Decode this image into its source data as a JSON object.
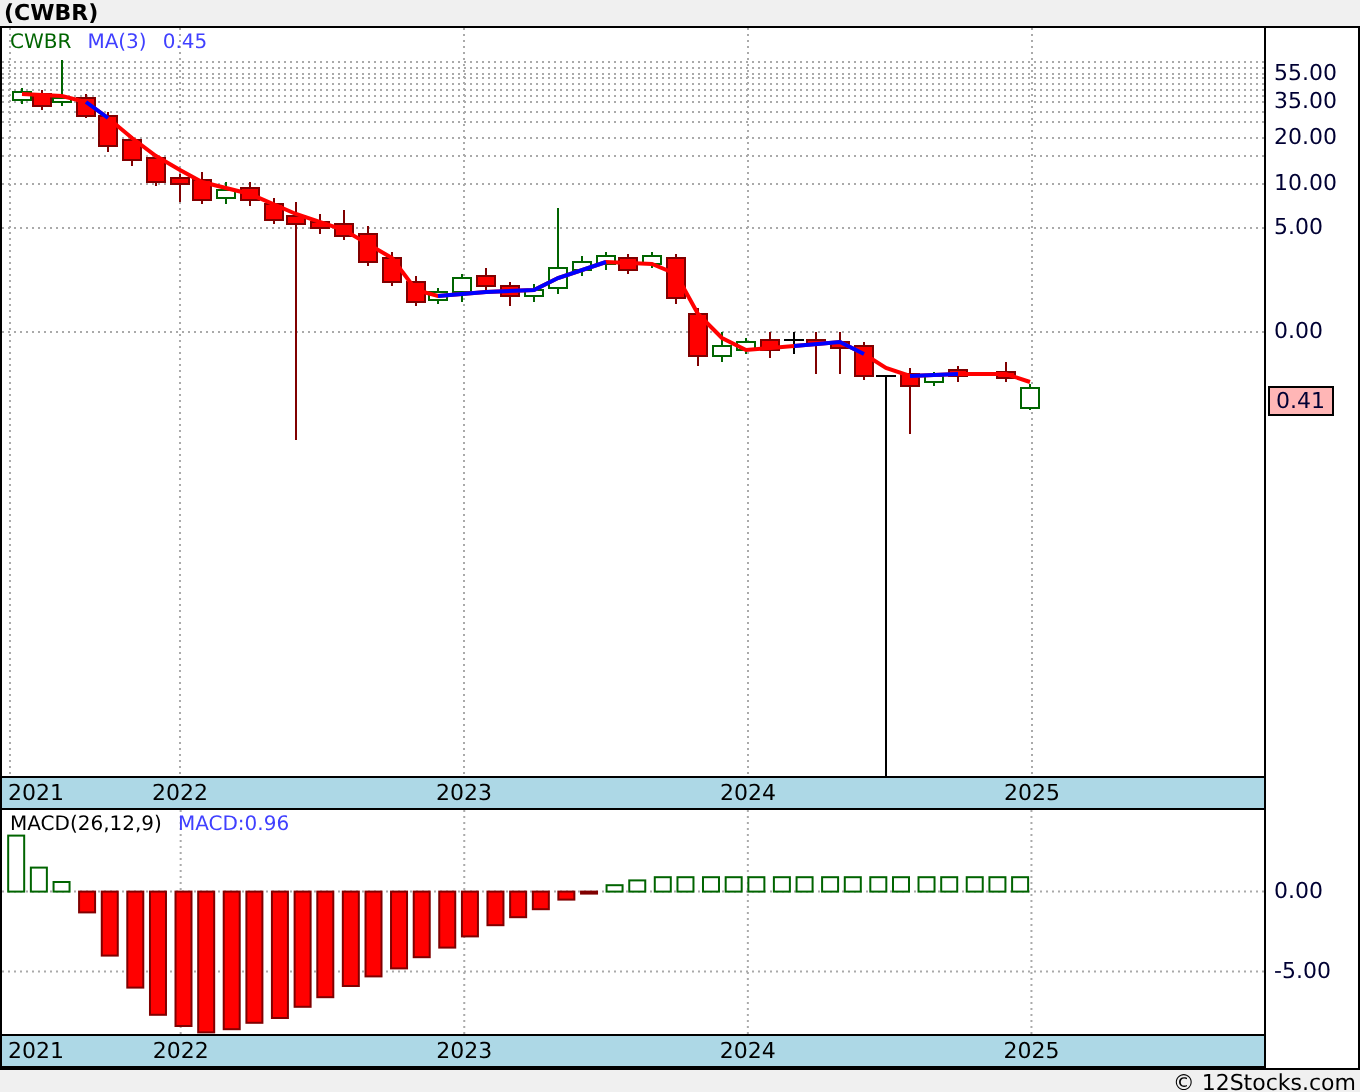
{
  "title": "(CWBR)",
  "price_chart": {
    "legend": {
      "symbol": "CWBR",
      "indicator": "MA(3)",
      "value": "0.45"
    },
    "y_axis_labels": [
      "55.00",
      "35.00",
      "20.00",
      "10.00",
      "5.00",
      "0.00"
    ],
    "last_price": "0.41",
    "x_axis_labels": [
      "2021",
      "2022",
      "2023",
      "2024",
      "2025"
    ]
  },
  "macd_chart": {
    "legend": {
      "indicator": "MACD(26,12,9)",
      "value": "MACD:0.96"
    },
    "start_year_label": "2021",
    "chart_data": {
      "type": "bar",
      "ylim": [
        -8.9,
        5.1
      ],
      "yticks": [
        {
          "value": 0,
          "label": "0.00"
        },
        {
          "value": -5,
          "label": "-5.00"
        }
      ],
      "grid": true,
      "xlim": [
        2021.37,
        2025.82
      ],
      "xticks": [
        {
          "value": 2022,
          "label": "2022"
        },
        {
          "value": 2023,
          "label": "2023"
        },
        {
          "value": 2024,
          "label": "2024"
        },
        {
          "value": 2025,
          "label": "2025"
        }
      ],
      "x": [
        2021.42,
        2021.5,
        2021.58,
        2021.67,
        2021.75,
        2021.84,
        2021.92,
        2022.01,
        2022.09,
        2022.18,
        2022.26,
        2022.35,
        2022.43,
        2022.51,
        2022.6,
        2022.68,
        2022.77,
        2022.85,
        2022.94,
        2023.02,
        2023.11,
        2023.19,
        2023.27,
        2023.36,
        2023.44,
        2023.53,
        2023.61,
        2023.7,
        2023.78,
        2023.87,
        2023.95,
        2024.03,
        2024.12,
        2024.2,
        2024.29,
        2024.37,
        2024.46,
        2024.54,
        2024.63,
        2024.71,
        2024.8,
        2024.88,
        2024.96
      ],
      "values": [
        3.5,
        1.5,
        0.6,
        -1.3,
        -4.0,
        -6.0,
        -7.7,
        -8.4,
        -8.8,
        -8.6,
        -8.2,
        -7.9,
        -7.2,
        -6.6,
        -5.9,
        -5.3,
        -4.8,
        -4.1,
        -3.5,
        -2.8,
        -2.1,
        -1.6,
        -1.1,
        -0.5,
        -0.1,
        0.4,
        0.7,
        0.9,
        0.9,
        0.9,
        0.9,
        0.9,
        0.9,
        0.9,
        0.9,
        0.9,
        0.9,
        0.9,
        0.9,
        0.9,
        0.9,
        0.9,
        0.9
      ]
    }
  },
  "footer": "© 12Stocks.com"
}
